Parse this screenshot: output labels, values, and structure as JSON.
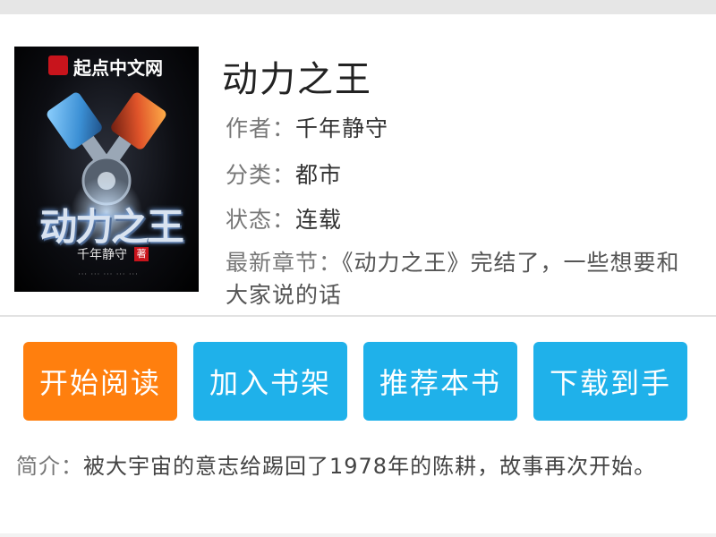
{
  "book": {
    "cover": {
      "logo_text": "起点中文网",
      "logo_icon": "qidian-logo-icon",
      "title": "动力之王",
      "author": "千年静守",
      "badge": "著",
      "fine_print": "··· ··· ··· ··· ···"
    },
    "title": "动力之王",
    "author_label": "作者：",
    "author": "千年静守",
    "category_label": "分类：",
    "category": "都市",
    "status_label": "状态：",
    "status": "连载",
    "latest_label": "最新章节：",
    "latest": "《动力之王》完结了，一些想要和大家说的话"
  },
  "actions": {
    "start_reading": "开始阅读",
    "add_shelf": "加入书架",
    "recommend": "推荐本书",
    "download": "下载到手"
  },
  "intro": {
    "label": "简介：",
    "text": "被大宇宙的意志给踢回了1978年的陈耕，故事再次开始。"
  },
  "colors": {
    "primary_button": "#ff7f0e",
    "secondary_button": "#1fb1ea"
  }
}
